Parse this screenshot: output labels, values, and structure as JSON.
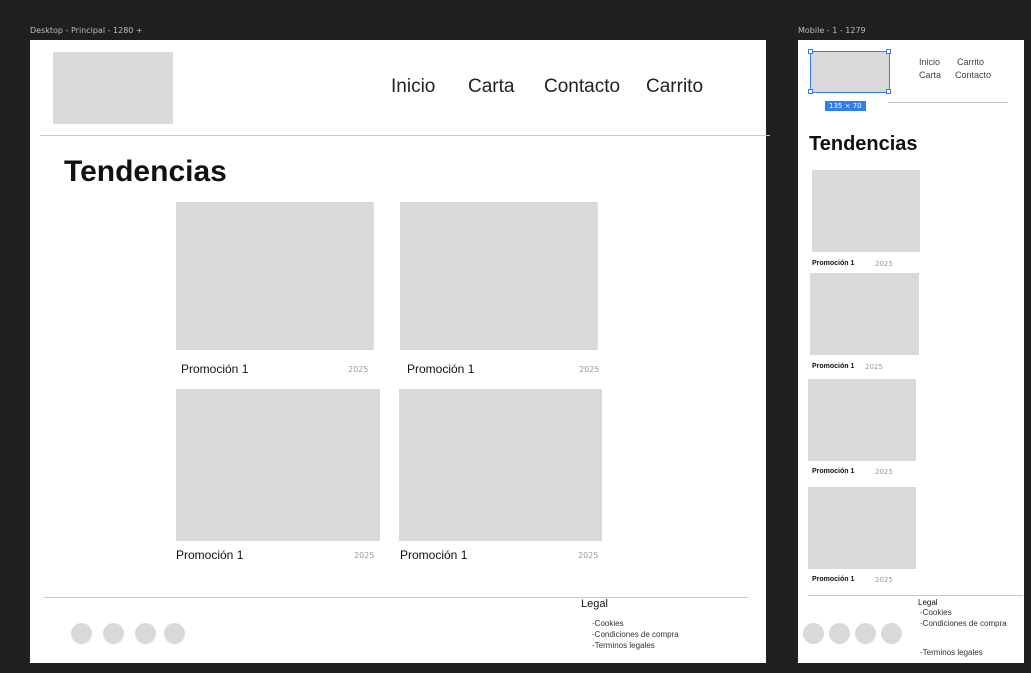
{
  "desktop": {
    "frame_label": "Desktop - Principal - 1280 +",
    "nav": [
      "Inicio",
      "Carta",
      "Contacto",
      "Carrito"
    ],
    "title": "Tendencias",
    "cards": [
      {
        "name": "Promoción 1",
        "year": "2025"
      },
      {
        "name": "Promoción 1",
        "year": "2025"
      },
      {
        "name": "Promoción 1",
        "year": "2025"
      },
      {
        "name": "Promoción 1",
        "year": "2025"
      }
    ],
    "footer": {
      "legal_title": "Legal",
      "legal_items": [
        "-Cookies",
        "-Condiciones de compra",
        "-Terminos legales"
      ]
    }
  },
  "mobile": {
    "frame_label": "Mobile - 1 - 1279",
    "nav_row1": [
      "Inicio",
      "Carrito"
    ],
    "nav_row2": [
      "Carta",
      "Contacto"
    ],
    "selection_size": "135 × 70",
    "title": "Tendencias",
    "cards": [
      {
        "name": "Promoción 1",
        "year": "2025"
      },
      {
        "name": "Promoción 1",
        "year": "2025"
      },
      {
        "name": "Promoción 1",
        "year": "2025"
      },
      {
        "name": "Promoción 1",
        "year": "2025"
      }
    ],
    "footer": {
      "legal_title": "Legal",
      "legal_items": [
        "-Cookies",
        "-Condiciones de compra",
        "-Terminos legales"
      ]
    }
  },
  "colors": {
    "canvas": "#1f1f1f",
    "frame": "#ffffff",
    "placeholder": "#d9d9d9",
    "selection": "#2f7ef5"
  }
}
